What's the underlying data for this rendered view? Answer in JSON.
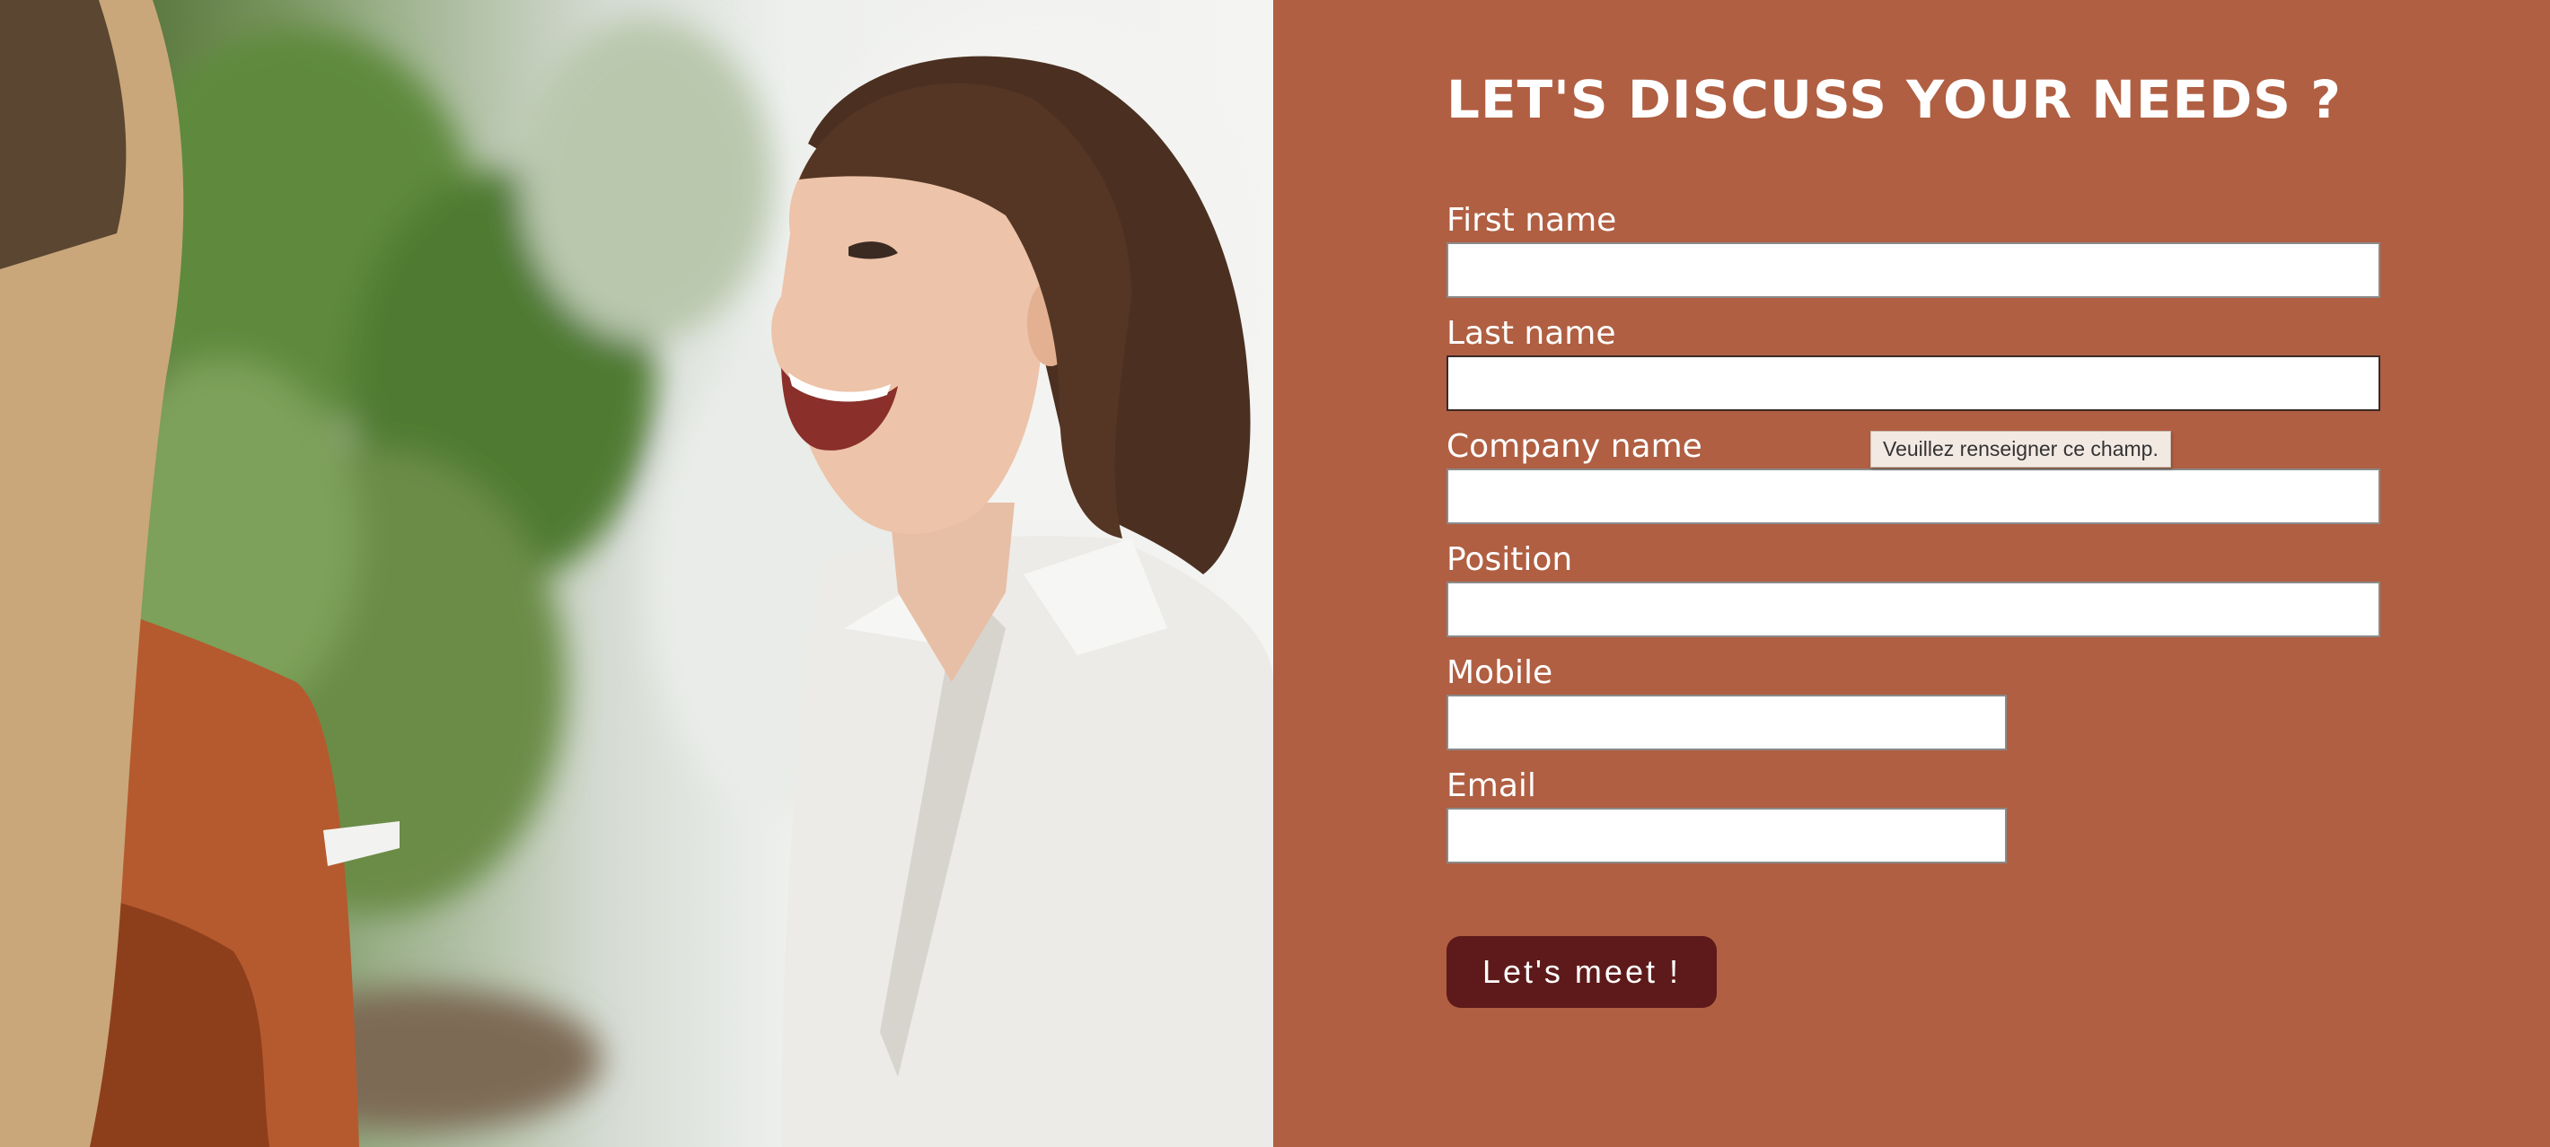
{
  "form": {
    "title": "LET'S DISCUSS YOUR NEEDS ?",
    "fields": [
      {
        "label": "First name",
        "value": ""
      },
      {
        "label": "Last name",
        "value": ""
      },
      {
        "label": "Company name",
        "value": ""
      },
      {
        "label": "Position",
        "value": ""
      },
      {
        "label": "Mobile",
        "value": ""
      },
      {
        "label": "Email",
        "value": ""
      }
    ],
    "validation_tooltip": "Veuillez renseigner ce champ.",
    "submit_label": "Let's meet !"
  },
  "photo": {
    "description_icon": "photo-image"
  },
  "colors": {
    "panel_background": "#b05f42",
    "button_background": "#5e1a1a",
    "text": "#ffffff"
  }
}
